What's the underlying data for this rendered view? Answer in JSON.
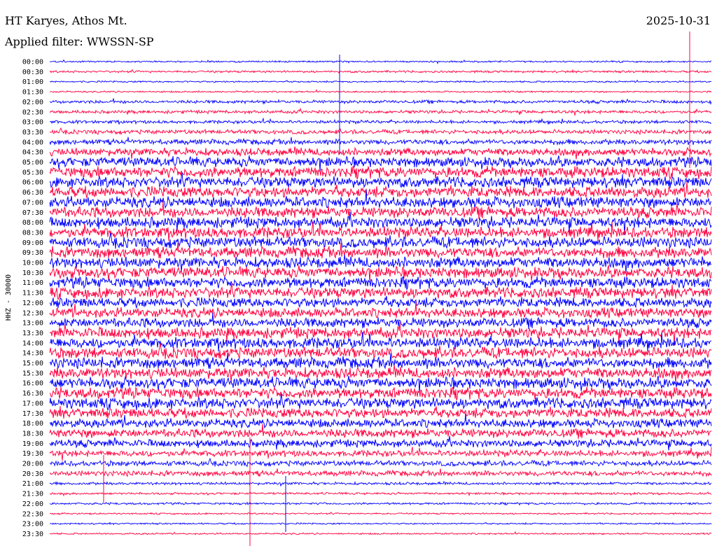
{
  "header": {
    "station": "HT Karyes, Athos Mt.",
    "date": "2025-10-31",
    "filter": "Applied filter: WWSSN-SP"
  },
  "chart_data": {
    "type": "line",
    "title": "HT Karyes, Athos Mt.",
    "subtitle": "Applied filter: WWSSN-SP",
    "date": "2025-10-31",
    "ylabel": "HHZ - 30000",
    "xlabel": "",
    "y_tick_labels": [
      "00:00",
      "00:30",
      "01:00",
      "01:30",
      "02:00",
      "02:30",
      "03:00",
      "03:30",
      "04:00",
      "04:30",
      "05:00",
      "05:30",
      "06:00",
      "06:30",
      "07:00",
      "07:30",
      "08:00",
      "08:30",
      "09:00",
      "09:30",
      "10:00",
      "10:30",
      "11:00",
      "11:30",
      "12:00",
      "12:30",
      "13:00",
      "13:30",
      "14:00",
      "14:30",
      "15:00",
      "15:30",
      "16:00",
      "16:30",
      "17:00",
      "17:30",
      "18:00",
      "18:30",
      "19:00",
      "19:30",
      "20:00",
      "20:30",
      "21:00",
      "21:30",
      "22:00",
      "22:30",
      "23:00",
      "23:30"
    ],
    "trace_colors": [
      "#0000ff",
      "#ff0040"
    ],
    "grid": false,
    "series": [
      {
        "start": "00:00",
        "amplitude": 0.15
      },
      {
        "start": "00:30",
        "amplitude": 0.2
      },
      {
        "start": "01:00",
        "amplitude": 0.15
      },
      {
        "start": "01:30",
        "amplitude": 0.15
      },
      {
        "start": "02:00",
        "amplitude": 0.3
      },
      {
        "start": "02:30",
        "amplitude": 0.3
      },
      {
        "start": "03:00",
        "amplitude": 0.3
      },
      {
        "start": "03:30",
        "amplitude": 0.4
      },
      {
        "start": "04:00",
        "amplitude": 0.5
      },
      {
        "start": "04:30",
        "amplitude": 0.7
      },
      {
        "start": "05:00",
        "amplitude": 0.9
      },
      {
        "start": "05:30",
        "amplitude": 1.0
      },
      {
        "start": "06:00",
        "amplitude": 1.0
      },
      {
        "start": "06:30",
        "amplitude": 1.0
      },
      {
        "start": "07:00",
        "amplitude": 1.0
      },
      {
        "start": "07:30",
        "amplitude": 1.0
      },
      {
        "start": "08:00",
        "amplitude": 1.0
      },
      {
        "start": "08:30",
        "amplitude": 1.0
      },
      {
        "start": "09:00",
        "amplitude": 1.0
      },
      {
        "start": "09:30",
        "amplitude": 1.0
      },
      {
        "start": "10:00",
        "amplitude": 1.0
      },
      {
        "start": "10:30",
        "amplitude": 1.0
      },
      {
        "start": "11:00",
        "amplitude": 1.0
      },
      {
        "start": "11:30",
        "amplitude": 1.0
      },
      {
        "start": "12:00",
        "amplitude": 0.9
      },
      {
        "start": "12:30",
        "amplitude": 0.9
      },
      {
        "start": "13:00",
        "amplitude": 0.9
      },
      {
        "start": "13:30",
        "amplitude": 1.0
      },
      {
        "start": "14:00",
        "amplitude": 1.0
      },
      {
        "start": "14:30",
        "amplitude": 1.0
      },
      {
        "start": "15:00",
        "amplitude": 1.0
      },
      {
        "start": "15:30",
        "amplitude": 1.0
      },
      {
        "start": "16:00",
        "amplitude": 1.0
      },
      {
        "start": "16:30",
        "amplitude": 1.0
      },
      {
        "start": "17:00",
        "amplitude": 1.0
      },
      {
        "start": "17:30",
        "amplitude": 0.9
      },
      {
        "start": "18:00",
        "amplitude": 0.8
      },
      {
        "start": "18:30",
        "amplitude": 0.8
      },
      {
        "start": "19:00",
        "amplitude": 0.7
      },
      {
        "start": "19:30",
        "amplitude": 0.6
      },
      {
        "start": "20:00",
        "amplitude": 0.5
      },
      {
        "start": "20:30",
        "amplitude": 0.5
      },
      {
        "start": "21:00",
        "amplitude": 0.25
      },
      {
        "start": "21:30",
        "amplitude": 0.2
      },
      {
        "start": "22:00",
        "amplitude": 0.2
      },
      {
        "start": "22:30",
        "amplitude": 0.15
      },
      {
        "start": "23:00",
        "amplitude": 0.15
      },
      {
        "start": "23:30",
        "amplitude": 0.15
      }
    ]
  }
}
